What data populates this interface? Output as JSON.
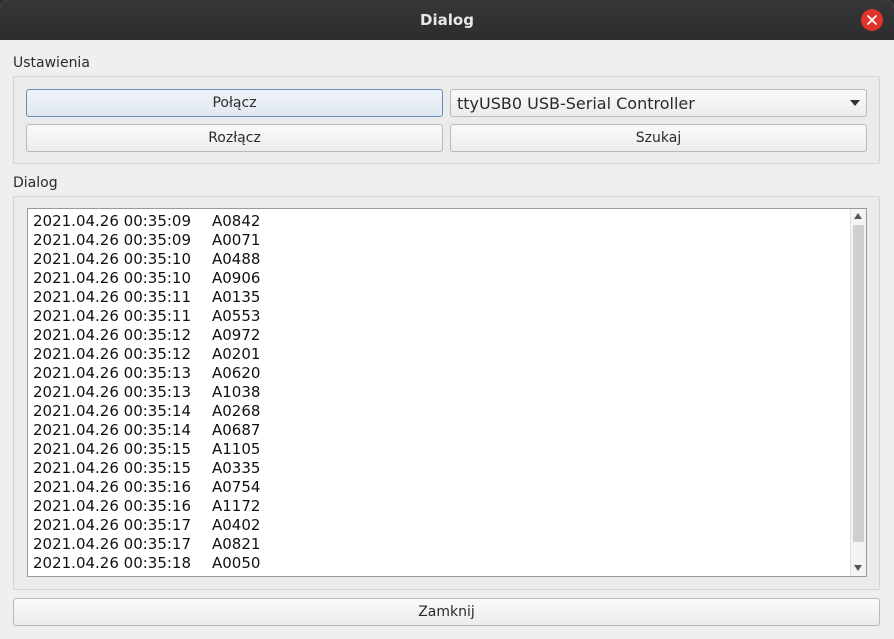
{
  "window": {
    "title": "Dialog"
  },
  "settings": {
    "group_label": "Ustawienia",
    "connect_label": "Połącz",
    "disconnect_label": "Rozłącz",
    "search_label": "Szukaj",
    "port_selected": "ttyUSB0 USB-Serial Controller"
  },
  "log": {
    "group_label": "Dialog",
    "rows": [
      {
        "ts": "2021.04.26 00:35:09",
        "code": "A0842"
      },
      {
        "ts": "2021.04.26 00:35:09",
        "code": "A0071"
      },
      {
        "ts": "2021.04.26 00:35:10",
        "code": "A0488"
      },
      {
        "ts": "2021.04.26 00:35:10",
        "code": "A0906"
      },
      {
        "ts": "2021.04.26 00:35:11",
        "code": "A0135"
      },
      {
        "ts": "2021.04.26 00:35:11",
        "code": "A0553"
      },
      {
        "ts": "2021.04.26 00:35:12",
        "code": "A0972"
      },
      {
        "ts": "2021.04.26 00:35:12",
        "code": "A0201"
      },
      {
        "ts": "2021.04.26 00:35:13",
        "code": "A0620"
      },
      {
        "ts": "2021.04.26 00:35:13",
        "code": "A1038"
      },
      {
        "ts": "2021.04.26 00:35:14",
        "code": "A0268"
      },
      {
        "ts": "2021.04.26 00:35:14",
        "code": "A0687"
      },
      {
        "ts": "2021.04.26 00:35:15",
        "code": "A1105"
      },
      {
        "ts": "2021.04.26 00:35:15",
        "code": "A0335"
      },
      {
        "ts": "2021.04.26 00:35:16",
        "code": "A0754"
      },
      {
        "ts": "2021.04.26 00:35:16",
        "code": "A1172"
      },
      {
        "ts": "2021.04.26 00:35:17",
        "code": "A0402"
      },
      {
        "ts": "2021.04.26 00:35:17",
        "code": "A0821"
      },
      {
        "ts": "2021.04.26 00:35:18",
        "code": "A0050"
      }
    ]
  },
  "footer": {
    "close_label": "Zamknij"
  },
  "colors": {
    "titlebar": "#2d2d2d",
    "close_button": "#e0332e",
    "focused_button_border": "#6a8fbd"
  },
  "icons": {
    "close": "close-icon",
    "combo_arrow": "chevron-down-icon"
  }
}
